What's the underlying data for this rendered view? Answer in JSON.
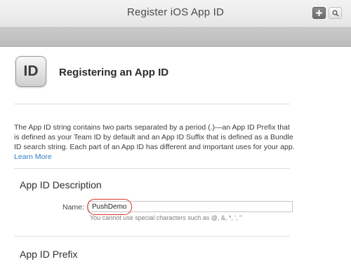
{
  "window": {
    "title": "Register iOS App ID",
    "add_icon": "plus-icon",
    "search_icon": "search-icon"
  },
  "header": {
    "icon_label": "ID",
    "title": "Registering an App ID"
  },
  "intro": {
    "text": "The App ID string contains two parts separated by a period (.)—an App ID Prefix that is defined as your Team ID by default and an App ID Suffix that is defined as a Bundle ID search string. Each part of an App ID has different and important uses for your app.",
    "link_text": "Learn More"
  },
  "sections": {
    "description_title": "App ID Description",
    "prefix_title": "App ID Prefix"
  },
  "form": {
    "name_label": "Name:",
    "name_value": "PushDemo",
    "name_hint": "You cannot use special characters such as @, &, *, ', \""
  },
  "colors": {
    "link": "#2d7ac6",
    "highlight_ring": "#d9342b"
  }
}
